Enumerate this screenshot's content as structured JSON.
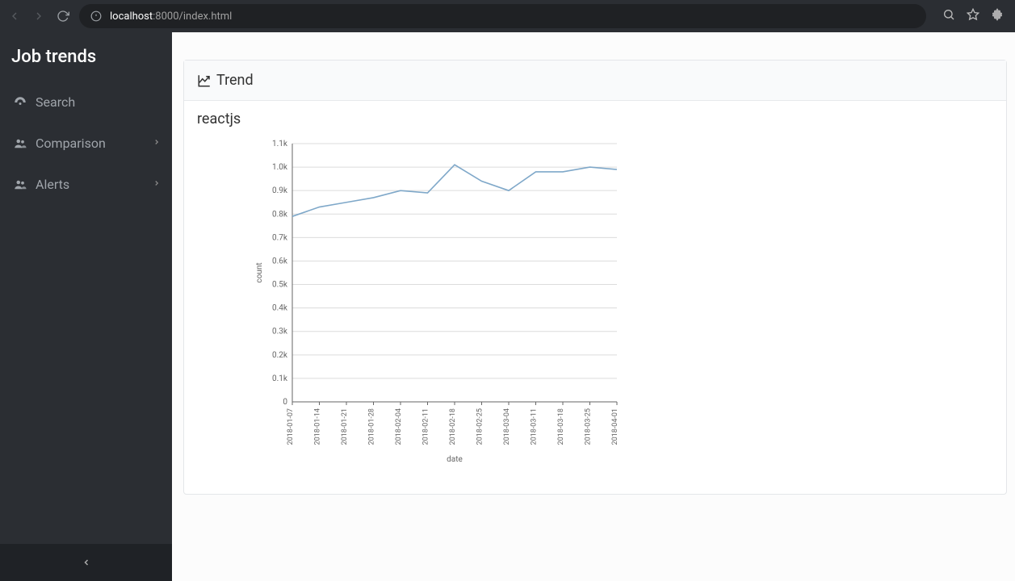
{
  "browser": {
    "url_host": "localhost",
    "url_port_path": ":8000/index.html"
  },
  "sidebar": {
    "title": "Job trends",
    "items": [
      {
        "label": "Search",
        "icon": "dashboard-icon",
        "chevron": false
      },
      {
        "label": "Comparison",
        "icon": "users-icon",
        "chevron": true
      },
      {
        "label": "Alerts",
        "icon": "users-icon",
        "chevron": true
      }
    ]
  },
  "card": {
    "title": "Trend",
    "subtitle": "reactjs"
  },
  "chart_data": {
    "type": "line",
    "title": "",
    "xlabel": "date",
    "ylabel": "count",
    "ylim": [
      0,
      1100
    ],
    "yticks": [
      0,
      100,
      200,
      300,
      400,
      500,
      600,
      700,
      800,
      900,
      1000,
      1100
    ],
    "ytick_labels": [
      "0",
      "0.1k",
      "0.2k",
      "0.3k",
      "0.4k",
      "0.5k",
      "0.6k",
      "0.7k",
      "0.8k",
      "0.9k",
      "1.0k",
      "1.1k"
    ],
    "categories": [
      "2018-01-07",
      "2018-01-14",
      "2018-01-21",
      "2018-01-28",
      "2018-02-04",
      "2018-02-11",
      "2018-02-18",
      "2018-02-25",
      "2018-03-04",
      "2018-03-11",
      "2018-03-18",
      "2018-03-25",
      "2018-04-01"
    ],
    "series": [
      {
        "name": "reactjs",
        "color": "#7fa8c9",
        "values": [
          790,
          830,
          850,
          870,
          900,
          890,
          1010,
          940,
          900,
          980,
          980,
          1000,
          990
        ]
      }
    ]
  }
}
